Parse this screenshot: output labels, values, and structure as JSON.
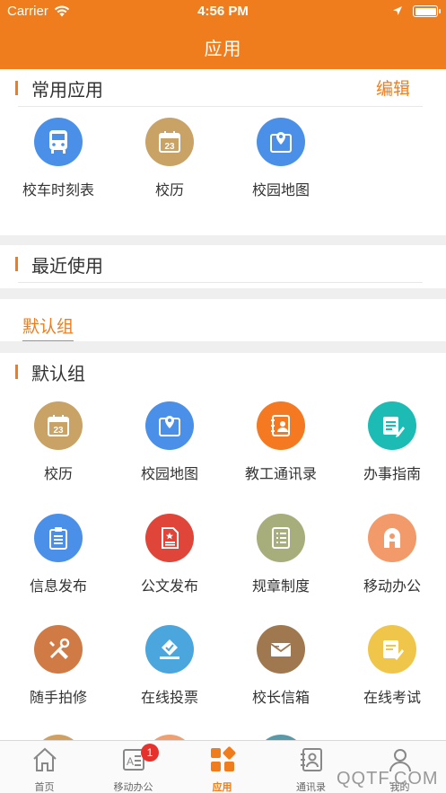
{
  "status_bar": {
    "carrier": "Carrier",
    "time": "4:56 PM"
  },
  "nav": {
    "title": "应用"
  },
  "common": {
    "title": "常用应用",
    "edit_label": "编辑",
    "apps": [
      {
        "label": "校车时刻表",
        "icon": "bus-icon",
        "color": "#4a90e8"
      },
      {
        "label": "校历",
        "icon": "calendar-icon",
        "color": "#c9a266"
      },
      {
        "label": "校园地图",
        "icon": "map-icon",
        "color": "#4a90e8"
      }
    ]
  },
  "recent": {
    "title": "最近使用"
  },
  "group_tab": {
    "label": "默认组"
  },
  "default_group": {
    "title": "默认组",
    "apps": [
      {
        "label": "校历",
        "icon": "calendar-icon",
        "color": "#c9a266"
      },
      {
        "label": "校园地图",
        "icon": "map-icon",
        "color": "#4a90e8"
      },
      {
        "label": "教工通讯录",
        "icon": "contacts-book-icon",
        "color": "#f47920"
      },
      {
        "label": "办事指南",
        "icon": "guide-icon",
        "color": "#1cbcb4"
      },
      {
        "label": "信息发布",
        "icon": "clipboard-icon",
        "color": "#4a90e8"
      },
      {
        "label": "公文发布",
        "icon": "document-icon",
        "color": "#e0453a"
      },
      {
        "label": "规章制度",
        "icon": "list-icon",
        "color": "#a8ad7c"
      },
      {
        "label": "移动办公",
        "icon": "mobile-office-icon",
        "color": "#f39a6a"
      },
      {
        "label": "随手拍修",
        "icon": "repair-tools-icon",
        "color": "#d07a45"
      },
      {
        "label": "在线投票",
        "icon": "vote-icon",
        "color": "#4aa6dc"
      },
      {
        "label": "校长信箱",
        "icon": "mailbox-icon",
        "color": "#a0784f"
      },
      {
        "label": "在线考试",
        "icon": "exam-icon",
        "color": "#f0c64a"
      }
    ]
  },
  "tabbar": {
    "tabs": [
      {
        "label": "首页",
        "icon": "home-icon"
      },
      {
        "label": "移动办公",
        "icon": "office-card-icon",
        "badge": "1"
      },
      {
        "label": "应用",
        "icon": "apps-grid-icon",
        "active": true
      },
      {
        "label": "通讯录",
        "icon": "contacts-icon"
      },
      {
        "label": "我的",
        "icon": "person-icon"
      }
    ]
  },
  "watermark": "QQTF.COM",
  "colors": {
    "accent": "#f07d1d",
    "badge": "#e5322d"
  }
}
